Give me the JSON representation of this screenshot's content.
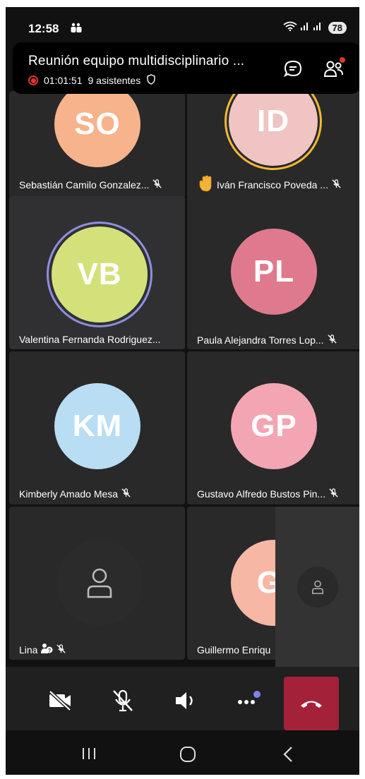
{
  "status": {
    "time": "12:58",
    "battery": "78"
  },
  "meeting": {
    "title": "Reunión equipo multidisciplinario ...",
    "duration": "01:01:51",
    "attendees": "9 asistentes"
  },
  "participants": [
    {
      "initials": "SO",
      "name": "Sebastián Camilo Gonzalez...",
      "color": "#F7B38B"
    },
    {
      "initials": "ID",
      "name": "Iván Francisco Poveda ...",
      "color": "#EFC4C2",
      "hand_raised": true
    },
    {
      "initials": "VB",
      "name": "Valentina Fernanda Rodriguez...",
      "color": "#D4E17A",
      "speaking": true
    },
    {
      "initials": "PL",
      "name": "Paula Alejandra Torres Lop...",
      "color": "#DF7A8E"
    },
    {
      "initials": "KM",
      "name": "Kimberly Amado Mesa",
      "color": "#B9DDF3"
    },
    {
      "initials": "GP",
      "name": "Gustavo Alfredo Bustos Pin...",
      "color": "#F4A5B3"
    },
    {
      "initials": "",
      "name": "Lina",
      "color": "#2B2B2B"
    },
    {
      "initials": "GI",
      "name": "Guillermo Enriqu",
      "color": "#F7B7A5"
    }
  ],
  "colors": {
    "accent_end": "#A4213A",
    "raised_ring": "#F2B935",
    "speaking_ring": "#8E8FE0",
    "record": "#E0352B"
  }
}
